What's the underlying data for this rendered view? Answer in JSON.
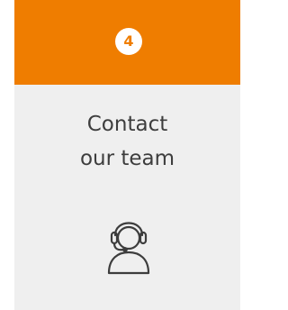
{
  "card": {
    "step_number": "4",
    "title_line_1": "Contact",
    "title_line_2": "our team",
    "icon": "customer-support-headset-icon",
    "colors": {
      "header": "#ef7d00",
      "card_background": "#efefef",
      "text": "#3d3d3d",
      "badge_background": "#ffffff",
      "badge_text": "#ef7d00"
    }
  }
}
